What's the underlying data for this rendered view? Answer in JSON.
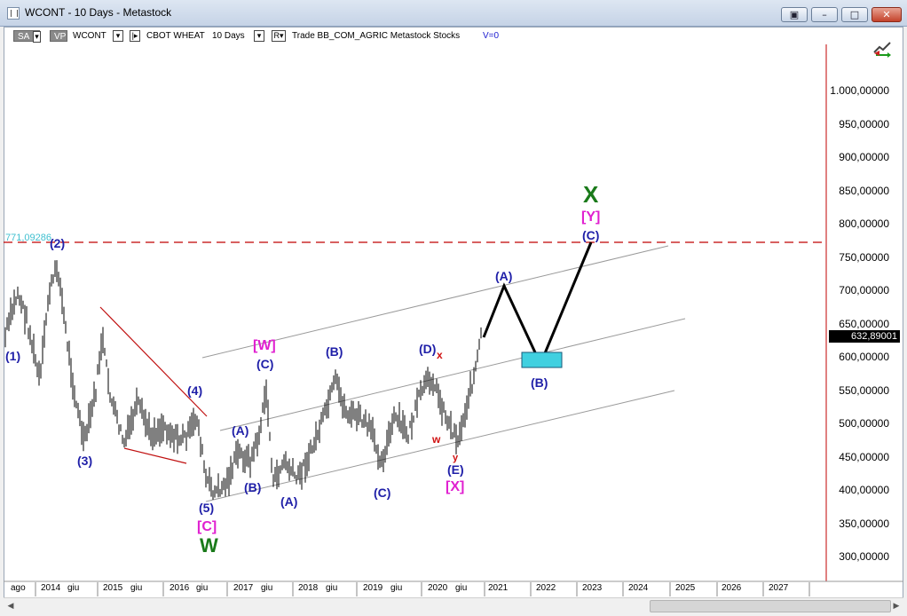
{
  "window": {
    "title": "WCONT - 10 Days - Metastock",
    "buttons": [
      "restore-down",
      "minimize",
      "maximize",
      "close"
    ]
  },
  "toolbar": {
    "sa": "SA",
    "vp": "VP",
    "symbol": "WCONT",
    "name": "CBOT WHEAT",
    "period": "10 Days",
    "box_r": "R",
    "info": "Trade  BB_COM_AGRIC  Metastock  Stocks",
    "volume": "V=0"
  },
  "price_axis": {
    "labels": [
      "1.000,00000",
      "950,00000",
      "900,00000",
      "850,00000",
      "800,00000",
      "750,00000",
      "700,00000",
      "650,00000",
      "600,00000",
      "550,00000",
      "500,00000",
      "450,00000",
      "400,00000",
      "350,00000",
      "300,00000"
    ],
    "current_price": "632,89001"
  },
  "time_axis": {
    "labels": [
      "ago",
      "2014",
      "giu",
      "2015",
      "giu",
      "2016",
      "giu",
      "2017",
      "giu",
      "2018",
      "giu",
      "2019",
      "giu",
      "2020",
      "giu",
      "2021",
      "2022",
      "2023",
      "2024",
      "2025",
      "2026",
      "2027"
    ]
  },
  "horizontal_line": {
    "label": "771,09286",
    "color": "#c00000"
  },
  "wave_labels": {
    "l1": "(1)",
    "l2": "(2)",
    "l3": "(3)",
    "l4": "(4)",
    "l5": "(5)",
    "C_bracket": "[C]",
    "W_big": "W",
    "A1": "(A)",
    "B1": "(B)",
    "A2": "(A)",
    "C1": "(C)",
    "W_bracket": "[W]",
    "B2": "(B)",
    "C2": "(C)",
    "D": "(D)",
    "E": "(E)",
    "X_bracket": "[X]",
    "x_small": "x",
    "w_small": "w",
    "y_small": "y",
    "A3": "(A)",
    "B3": "(B)",
    "C3": "(C)",
    "Y_bracket": "[Y]",
    "X_big": "X"
  },
  "colors": {
    "wave_blue": "#1f1fa8",
    "magenta": "#e020d0",
    "green": "#1a7a1a",
    "red_small": "#d01010",
    "target_box": "#40d0e0",
    "price_bars": "#000000",
    "channel": "#9a9a9a",
    "triangle": "#c01010"
  }
}
